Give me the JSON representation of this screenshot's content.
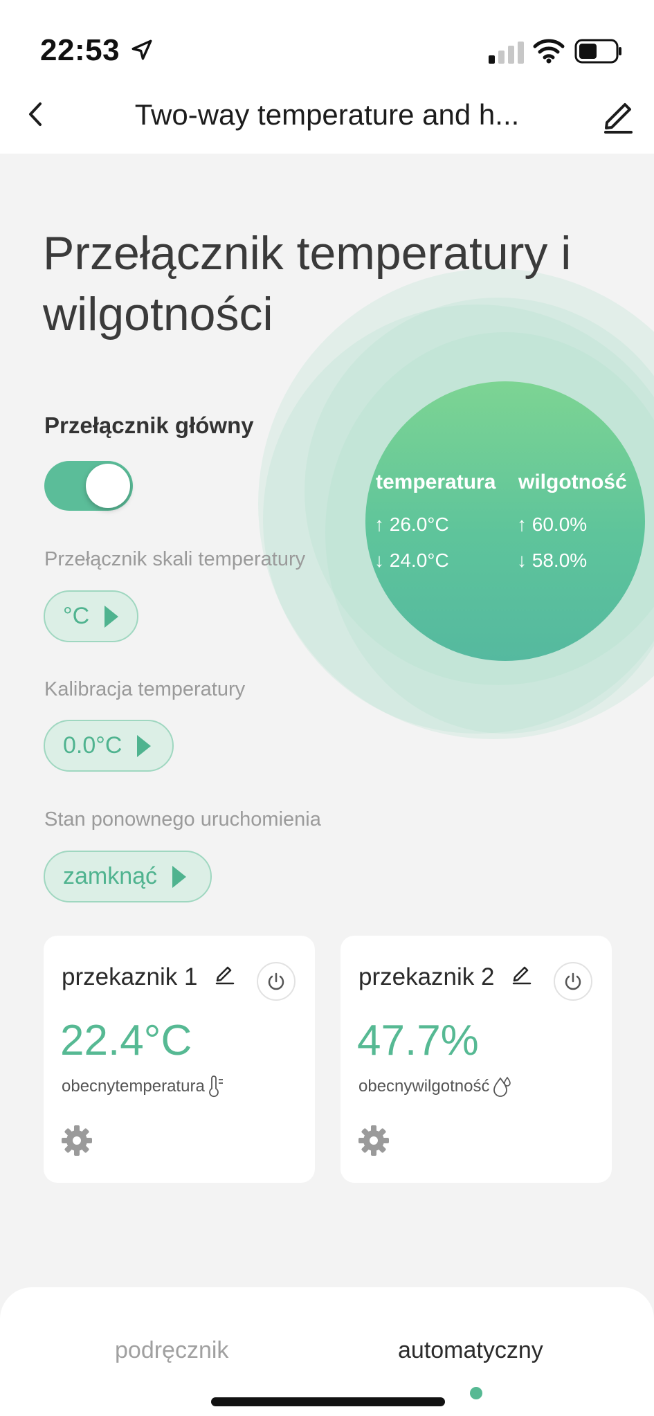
{
  "status_bar": {
    "time": "22:53",
    "icons": [
      "location-arrow-icon",
      "cellular-signal-icon",
      "wifi-icon",
      "battery-icon"
    ]
  },
  "nav": {
    "title": "Two-way temperature and h...",
    "back_icon": "chevron-left-icon",
    "edit_icon": "pencil-icon"
  },
  "page": {
    "title": "Przełącznik temperatury i wilgotności"
  },
  "main_switch": {
    "label": "Przełącznik główny",
    "on": true
  },
  "settings": {
    "scale_label": "Przełącznik skali temperatury",
    "scale_value": "°C",
    "calibration_label": "Kalibracja temperatury",
    "calibration_value": "0.0°C",
    "restart_label": "Stan ponownego uruchomienia",
    "restart_value": "zamknąć"
  },
  "summary": {
    "temp_heading": "temperatura",
    "hum_heading": "wilgotność",
    "temp_high": "↑ 26.0°C",
    "temp_low": "↓ 24.0°C",
    "hum_high": "↑ 60.0%",
    "hum_low": "↓ 58.0%"
  },
  "relays": [
    {
      "title": "przekaznik 1",
      "value": "22.4°C",
      "subtitle": "obecnytemperatura",
      "sub_icon": "thermometer-icon"
    },
    {
      "title": "przekaznik 2",
      "value": "47.7%",
      "subtitle": "obecnywilgotność",
      "sub_icon": "droplet-icon"
    }
  ],
  "tabs": {
    "manual": "podręcznik",
    "auto": "automatyczny",
    "active": "auto"
  },
  "colors": {
    "accent": "#56b993",
    "pill_bg": "#dcefe6",
    "circle_top": "#7dd493",
    "circle_bottom": "#55b99f"
  }
}
